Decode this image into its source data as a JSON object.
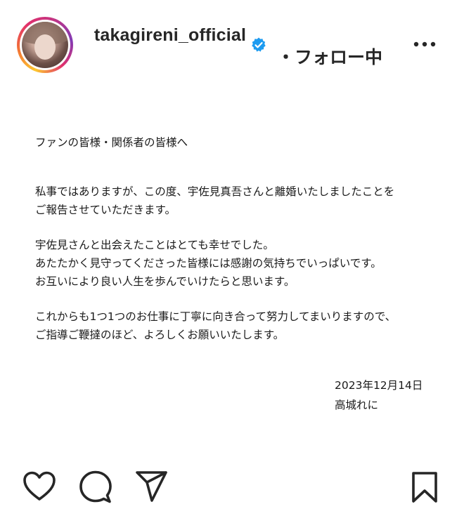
{
  "header": {
    "username": "takagireni_official",
    "follow_label": "・フォロー中",
    "verified_icon": "verified-badge-icon",
    "more_icon": "more-options-icon",
    "accent_ring": "#e1306c",
    "verified_color": "#1d9bf0"
  },
  "post": {
    "greeting": "ファンの皆様・関係者の皆様へ",
    "paragraphs": [
      {
        "lines": [
          "私事ではありますが、この度、宇佐見真吾さんと離婚いたしましたことを",
          "ご報告させていただきます。"
        ]
      },
      {
        "lines": [
          "宇佐見さんと出会えたことはとても幸せでした。",
          "あたたかく見守ってくださった皆様には感謝の気持ちでいっぱいです。",
          "お互いにより良い人生を歩んでいけたらと思います。"
        ]
      },
      {
        "lines": [
          "これからも1つ1つのお仕事に丁寧に向き合って努力してまいりますので、",
          "ご指導ご鞭撻のほど、よろしくお願いいたします。"
        ]
      }
    ],
    "date": "2023年12月14日",
    "signature": "高城れに"
  },
  "actions": {
    "like_icon": "heart-icon",
    "comment_icon": "comment-icon",
    "share_icon": "share-icon",
    "save_icon": "bookmark-icon"
  }
}
